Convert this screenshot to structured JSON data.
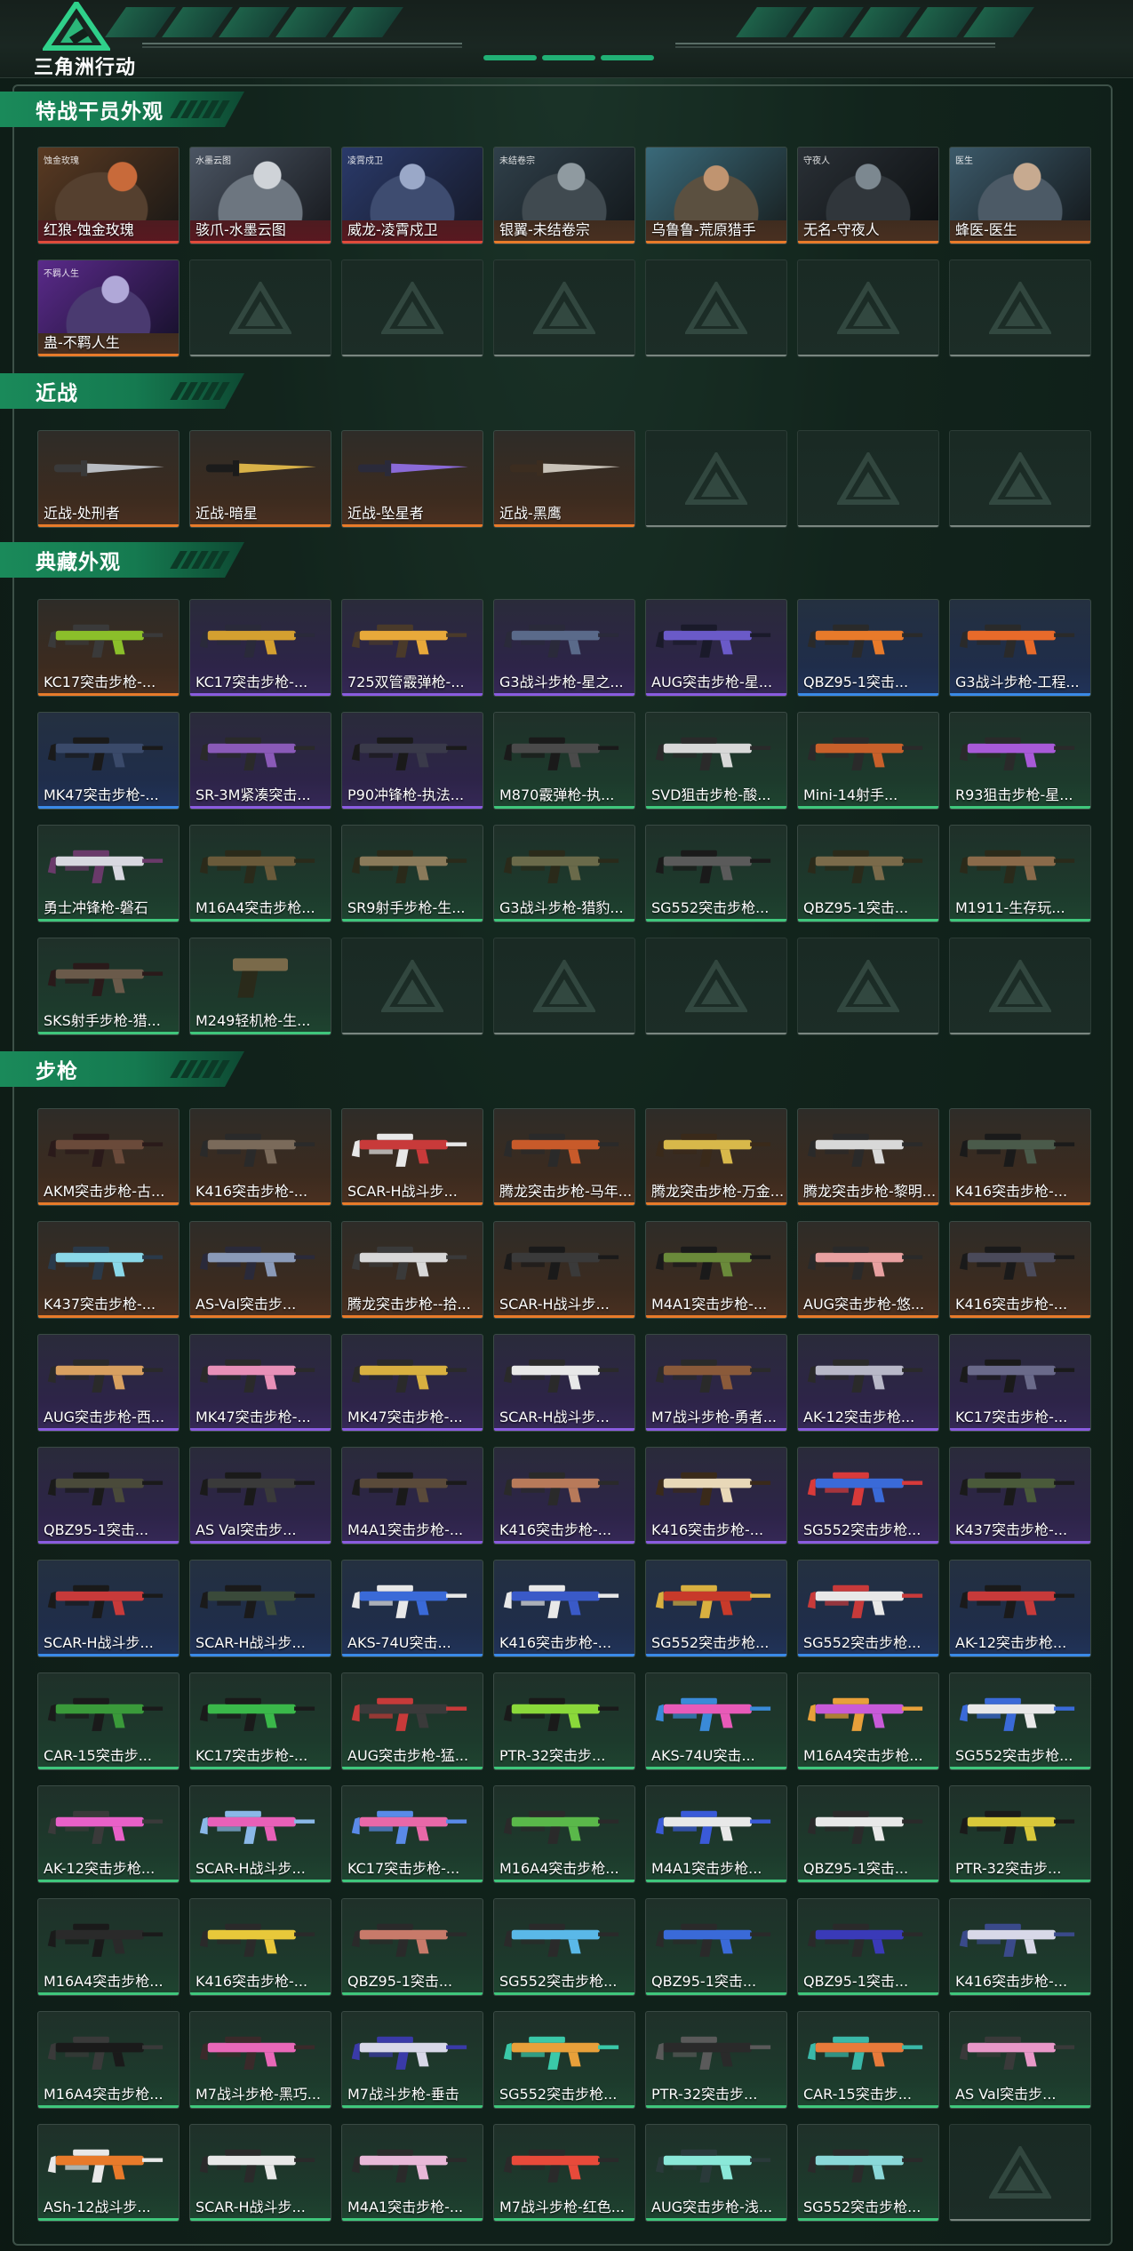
{
  "app": {
    "title": "三角洲行动"
  },
  "sections": [
    {
      "title": "特战干员外观",
      "items": [
        {
          "label": "红狼-蚀金玫瑰",
          "q": "red",
          "kind": "portrait",
          "variant": "p1",
          "tag": "蚀金玫瑰"
        },
        {
          "label": "骇爪-水墨云图",
          "q": "red",
          "kind": "portrait",
          "variant": "p2",
          "tag": "水墨云图"
        },
        {
          "label": "威龙-凌霄戍卫",
          "q": "red",
          "kind": "portrait",
          "variant": "p3",
          "tag": "凌霄戍卫"
        },
        {
          "label": "银翼-未结卷宗",
          "q": "orange",
          "kind": "portrait",
          "variant": "p4",
          "tag": "未结卷宗"
        },
        {
          "label": "乌鲁鲁-荒原猎手",
          "q": "orange",
          "kind": "portrait",
          "variant": "p5",
          "tag": ""
        },
        {
          "label": "无名-守夜人",
          "q": "orange",
          "kind": "portrait",
          "variant": "p6",
          "tag": "守夜人"
        },
        {
          "label": "蜂医-医生",
          "q": "orange",
          "kind": "portrait",
          "variant": "p7",
          "tag": "医生"
        },
        {
          "label": "蛊-不羁人生",
          "q": "orange",
          "kind": "portrait",
          "variant": "p8",
          "tag": "不羁人生"
        },
        {
          "label": "",
          "q": "empty"
        },
        {
          "label": "",
          "q": "empty"
        },
        {
          "label": "",
          "q": "empty"
        },
        {
          "label": "",
          "q": "empty"
        },
        {
          "label": "",
          "q": "empty"
        },
        {
          "label": "",
          "q": "empty"
        }
      ]
    },
    {
      "title": "近战",
      "items": [
        {
          "label": "近战-处刑者",
          "q": "orange",
          "kind": "knife",
          "c1": "#b8bcc2",
          "c2": "#3a3a3a"
        },
        {
          "label": "近战-暗星",
          "q": "orange",
          "kind": "knife",
          "c1": "#d9b248",
          "c2": "#1b1b1b"
        },
        {
          "label": "近战-坠星者",
          "q": "orange",
          "kind": "knife",
          "c1": "#8a6ad8",
          "c2": "#2a2a3a"
        },
        {
          "label": "近战-黑鹰",
          "q": "orange",
          "kind": "knife",
          "c1": "#c8c2b8",
          "c2": "#3c2d20"
        },
        {
          "label": "",
          "q": "empty"
        },
        {
          "label": "",
          "q": "empty"
        },
        {
          "label": "",
          "q": "empty"
        }
      ]
    },
    {
      "title": "典藏外观",
      "items": [
        {
          "label": "KC17突击步枪-...",
          "q": "orange",
          "kind": "gun",
          "c1": "#8bbf2a",
          "c2": "#3a3a3a"
        },
        {
          "label": "KC17突击步枪-...",
          "q": "purple",
          "kind": "gun",
          "c1": "#d4a030",
          "c2": "#2a2a3a"
        },
        {
          "label": "725双管霰弹枪-...",
          "q": "purple",
          "kind": "gun",
          "c1": "#e8a93a",
          "c2": "#4a3a2a"
        },
        {
          "label": "G3战斗步枪-星之...",
          "q": "purple",
          "kind": "gun",
          "c1": "#5a6a8a",
          "c2": "#2a2a3a"
        },
        {
          "label": "AUG突击步枪-星...",
          "q": "purple",
          "kind": "gun",
          "c1": "#6a5ac8",
          "c2": "#1a1a2a"
        },
        {
          "label": "QBZ95-1突击...",
          "q": "blue",
          "kind": "gun",
          "c1": "#e87a2a",
          "c2": "#2a2a2a"
        },
        {
          "label": "G3战斗步枪-工程...",
          "q": "blue",
          "kind": "gun",
          "c1": "#e86a2a",
          "c2": "#2a2a2a"
        },
        {
          "label": "MK47突击步枪-...",
          "q": "blue",
          "kind": "gun",
          "c1": "#3a4a6a",
          "c2": "#1a1a1a"
        },
        {
          "label": "SR-3M紧凑突击...",
          "q": "purple",
          "kind": "gun",
          "c1": "#8a5ab8",
          "c2": "#2a2a2a"
        },
        {
          "label": "P90冲锋枪-执法...",
          "q": "purple",
          "kind": "gun",
          "c1": "#3a3a4a",
          "c2": "#1a1a1a"
        },
        {
          "label": "M870霰弹枪-执...",
          "q": "green",
          "kind": "gun",
          "c1": "#4a4a4a",
          "c2": "#1a1a1a"
        },
        {
          "label": "SVD狙击步枪-酸...",
          "q": "green",
          "kind": "gun",
          "c1": "#d8d8d8",
          "c2": "#2a2a2a"
        },
        {
          "label": "Mini-14射手...",
          "q": "green",
          "kind": "gun",
          "c1": "#c8602a",
          "c2": "#2a2a2a"
        },
        {
          "label": "R93狙击步枪-星...",
          "q": "green",
          "kind": "gun",
          "c1": "#a85ad8",
          "c2": "#2a2a2a"
        },
        {
          "label": "勇士冲锋枪-磐石",
          "q": "green",
          "kind": "gun",
          "c1": "#d8d8e0",
          "c2": "#6a3a6a"
        },
        {
          "label": "M16A4突击步枪...",
          "q": "green",
          "kind": "gun",
          "c1": "#6a5a3a",
          "c2": "#2a2a1a"
        },
        {
          "label": "SR9射手步枪-生...",
          "q": "green",
          "kind": "gun",
          "c1": "#8a7a5a",
          "c2": "#2a2a1a"
        },
        {
          "label": "G3战斗步枪-猎豹...",
          "q": "green",
          "kind": "gun",
          "c1": "#6a6a4a",
          "c2": "#2a2a1a"
        },
        {
          "label": "SG552突击步枪...",
          "q": "green",
          "kind": "gun",
          "c1": "#5a5a5a",
          "c2": "#1a1a1a"
        },
        {
          "label": "QBZ95-1突击...",
          "q": "green",
          "kind": "gun",
          "c1": "#7a6a4a",
          "c2": "#2a2a1a"
        },
        {
          "label": "M1911-生存玩...",
          "q": "green",
          "kind": "gun",
          "c1": "#8a6a4a",
          "c2": "#2a2a1a"
        },
        {
          "label": "SKS射手步枪-猎...",
          "q": "green",
          "kind": "gun",
          "c1": "#6a5a4a",
          "c2": "#2a1a1a"
        },
        {
          "label": "M249轻机枪-生...",
          "q": "green",
          "kind": "pistol",
          "c1": "#7a6a4a",
          "c2": "#2a2a1a"
        },
        {
          "label": "",
          "q": "empty"
        },
        {
          "label": "",
          "q": "empty"
        },
        {
          "label": "",
          "q": "empty"
        },
        {
          "label": "",
          "q": "empty"
        },
        {
          "label": "",
          "q": "empty"
        }
      ]
    },
    {
      "title": "步枪",
      "items": [
        {
          "label": "AKM突击步枪-古...",
          "q": "orange",
          "kind": "gun",
          "c1": "#6a4a3a",
          "c2": "#2a1a1a"
        },
        {
          "label": "K416突击步枪-...",
          "q": "orange",
          "kind": "gun",
          "c1": "#7a6a5a",
          "c2": "#2a2a2a"
        },
        {
          "label": "SCAR-H战斗步...",
          "q": "orange",
          "kind": "gun",
          "c1": "#c83a3a",
          "c2": "#e8e8e8"
        },
        {
          "label": "腾龙突击步枪-马年...",
          "q": "orange",
          "kind": "gun",
          "c1": "#c85a2a",
          "c2": "#2a2a2a"
        },
        {
          "label": "腾龙突击步枪-万金...",
          "q": "orange",
          "kind": "gun",
          "c1": "#d8b84a",
          "c2": "#3a2a1a"
        },
        {
          "label": "腾龙突击步枪-黎明...",
          "q": "orange",
          "kind": "gun",
          "c1": "#d8d8d8",
          "c2": "#2a2a2a"
        },
        {
          "label": "K416突击步枪-...",
          "q": "orange",
          "kind": "gun",
          "c1": "#4a5a4a",
          "c2": "#1a1a1a"
        },
        {
          "label": "K437突击步枪-...",
          "q": "orange",
          "kind": "gun",
          "c1": "#8ad8e8",
          "c2": "#2a3a4a"
        },
        {
          "label": "AS-Val突击步...",
          "q": "orange",
          "kind": "gun",
          "c1": "#8a9ab8",
          "c2": "#2a2a3a"
        },
        {
          "label": "腾龙突击步枪--拾...",
          "q": "orange",
          "kind": "gun",
          "c1": "#d8d8d8",
          "c2": "#3a3a3a"
        },
        {
          "label": "SCAR-H战斗步...",
          "q": "orange",
          "kind": "gun",
          "c1": "#3a3a3a",
          "c2": "#1a1a1a"
        },
        {
          "label": "M4A1突击步枪-...",
          "q": "orange",
          "kind": "gun",
          "c1": "#6a8a3a",
          "c2": "#1a1a1a"
        },
        {
          "label": "AUG突击步枪-悠...",
          "q": "orange",
          "kind": "gun",
          "c1": "#e8a0a0",
          "c2": "#2a2a2a"
        },
        {
          "label": "K416突击步枪-...",
          "q": "orange",
          "kind": "gun",
          "c1": "#4a4a5a",
          "c2": "#1a1a1a"
        },
        {
          "label": "AUG突击步枪-西...",
          "q": "purple",
          "kind": "gun",
          "c1": "#d8a060",
          "c2": "#2a2a2a"
        },
        {
          "label": "MK47突击步枪-...",
          "q": "purple",
          "kind": "gun",
          "c1": "#e890b8",
          "c2": "#2a2a2a"
        },
        {
          "label": "MK47突击步枪-...",
          "q": "purple",
          "kind": "gun",
          "c1": "#d8b040",
          "c2": "#2a2a2a"
        },
        {
          "label": "SCAR-H战斗步...",
          "q": "purple",
          "kind": "gun",
          "c1": "#e8e8e8",
          "c2": "#2a2a2a"
        },
        {
          "label": "M7战斗步枪-勇者...",
          "q": "purple",
          "kind": "gun",
          "c1": "#8a5a3a",
          "c2": "#2a2a2a"
        },
        {
          "label": "AK-12突击步枪...",
          "q": "purple",
          "kind": "gun",
          "c1": "#b8b8c8",
          "c2": "#2a2a2a"
        },
        {
          "label": "KC17突击步枪-...",
          "q": "purple",
          "kind": "gun",
          "c1": "#6a6a8a",
          "c2": "#1a1a1a"
        },
        {
          "label": "QBZ95-1突击...",
          "q": "purple",
          "kind": "gun",
          "c1": "#4a4a3a",
          "c2": "#1a1a1a"
        },
        {
          "label": "AS Val突击步...",
          "q": "purple",
          "kind": "gun",
          "c1": "#3a3a3a",
          "c2": "#1a1a1a"
        },
        {
          "label": "M4A1突击步枪-...",
          "q": "purple",
          "kind": "gun",
          "c1": "#5a4a3a",
          "c2": "#1a1a1a"
        },
        {
          "label": "K416突击步枪-...",
          "q": "purple",
          "kind": "gun",
          "c1": "#b87a5a",
          "c2": "#2a2a2a"
        },
        {
          "label": "K416突击步枪-...",
          "q": "purple",
          "kind": "gun",
          "c1": "#e8d8b8",
          "c2": "#3a2a1a"
        },
        {
          "label": "SG552突击步枪...",
          "q": "purple",
          "kind": "gun",
          "c1": "#3a6ad8",
          "c2": "#d83a3a"
        },
        {
          "label": "K437突击步枪-...",
          "q": "purple",
          "kind": "gun",
          "c1": "#4a5a3a",
          "c2": "#1a1a1a"
        },
        {
          "label": "SCAR-H战斗步...",
          "q": "blue",
          "kind": "gun",
          "c1": "#c83a3a",
          "c2": "#1a1a1a"
        },
        {
          "label": "SCAR-H战斗步...",
          "q": "blue",
          "kind": "gun",
          "c1": "#3a4a3a",
          "c2": "#1a1a1a"
        },
        {
          "label": "AKS-74U突击...",
          "q": "blue",
          "kind": "gun",
          "c1": "#3a6ad8",
          "c2": "#e8e8e8"
        },
        {
          "label": "K416突击步枪-...",
          "q": "blue",
          "kind": "gun",
          "c1": "#3a5ac8",
          "c2": "#e8e8e8"
        },
        {
          "label": "SG552突击步枪...",
          "q": "blue",
          "kind": "gun",
          "c1": "#c83a2a",
          "c2": "#d8b040"
        },
        {
          "label": "SG552突击步枪...",
          "q": "blue",
          "kind": "gun",
          "c1": "#e8e8e8",
          "c2": "#c83a3a"
        },
        {
          "label": "AK-12突击步枪...",
          "q": "blue",
          "kind": "gun",
          "c1": "#c83a3a",
          "c2": "#1a1a1a"
        },
        {
          "label": "CAR-15突击步...",
          "q": "green",
          "kind": "gun",
          "c1": "#3a9a3a",
          "c2": "#1a1a1a"
        },
        {
          "label": "KC17突击步枪-...",
          "q": "green",
          "kind": "gun",
          "c1": "#3ab84a",
          "c2": "#1a1a1a"
        },
        {
          "label": "AUG突击步枪-猛...",
          "q": "green",
          "kind": "gun",
          "c1": "#3a3a3a",
          "c2": "#c83a3a"
        },
        {
          "label": "PTR-32突击步...",
          "q": "green",
          "kind": "gun",
          "c1": "#8ad83a",
          "c2": "#1a1a1a"
        },
        {
          "label": "AKS-74U突击...",
          "q": "green",
          "kind": "gun",
          "c1": "#e85ab8",
          "c2": "#3a8ad8"
        },
        {
          "label": "M16A4突击步枪...",
          "q": "green",
          "kind": "gun",
          "c1": "#c85ad8",
          "c2": "#e8a03a"
        },
        {
          "label": "SG552突击步枪...",
          "q": "green",
          "kind": "gun",
          "c1": "#e8e8e8",
          "c2": "#3a6ad8"
        },
        {
          "label": "AK-12突击步枪...",
          "q": "green",
          "kind": "gun",
          "c1": "#e860c8",
          "c2": "#3a3a3a"
        },
        {
          "label": "SCAR-H战斗步...",
          "q": "green",
          "kind": "gun",
          "c1": "#e860b8",
          "c2": "#8ab8e8"
        },
        {
          "label": "KC17突击步枪-...",
          "q": "green",
          "kind": "gun",
          "c1": "#e868a8",
          "c2": "#5a8ae8"
        },
        {
          "label": "M16A4突击步枪...",
          "q": "green",
          "kind": "gun",
          "c1": "#5ab84a",
          "c2": "#2a2a2a"
        },
        {
          "label": "M4A1突击步枪...",
          "q": "green",
          "kind": "gun",
          "c1": "#e8e8e8",
          "c2": "#3a5ad8"
        },
        {
          "label": "QBZ95-1突击...",
          "q": "green",
          "kind": "gun",
          "c1": "#e8e8e8",
          "c2": "#2a2a2a"
        },
        {
          "label": "PTR-32突击步...",
          "q": "green",
          "kind": "gun",
          "c1": "#d8c83a",
          "c2": "#1a1a1a"
        },
        {
          "label": "M16A4突击步枪...",
          "q": "green",
          "kind": "gun",
          "c1": "#2a2a2a",
          "c2": "#1a1a1a"
        },
        {
          "label": "K416突击步枪-...",
          "q": "green",
          "kind": "gun",
          "c1": "#e8c83a",
          "c2": "#2a2a2a"
        },
        {
          "label": "QBZ95-1突击...",
          "q": "green",
          "kind": "gun",
          "c1": "#c87a6a",
          "c2": "#2a2a2a"
        },
        {
          "label": "SG552突击步枪...",
          "q": "green",
          "kind": "gun",
          "c1": "#5ab8e8",
          "c2": "#2a2a2a"
        },
        {
          "label": "QBZ95-1突击...",
          "q": "green",
          "kind": "gun",
          "c1": "#3a6ad8",
          "c2": "#2a2a2a"
        },
        {
          "label": "QBZ95-1突击...",
          "q": "green",
          "kind": "gun",
          "c1": "#3a3ab8",
          "c2": "#2a2a2a"
        },
        {
          "label": "K416突击步枪-...",
          "q": "green",
          "kind": "gun",
          "c1": "#d8d8e8",
          "c2": "#3a4a8a"
        },
        {
          "label": "M16A4突击步枪...",
          "q": "green",
          "kind": "gun",
          "c1": "#1a1a1a",
          "c2": "#3a3a3a"
        },
        {
          "label": "M7战斗步枪-黑巧...",
          "q": "green",
          "kind": "gun",
          "c1": "#e868b8",
          "c2": "#3a2a2a"
        },
        {
          "label": "M7战斗步枪-垂击",
          "q": "green",
          "kind": "gun",
          "c1": "#d8d8e8",
          "c2": "#3a3aa8"
        },
        {
          "label": "SG552突击步枪...",
          "q": "green",
          "kind": "gun",
          "c1": "#e8a03a",
          "c2": "#3ac8a8"
        },
        {
          "label": "PTR-32突击步...",
          "q": "green",
          "kind": "gun",
          "c1": "#2a2a2a",
          "c2": "#5a5a5a"
        },
        {
          "label": "CAR-15突击步...",
          "q": "green",
          "kind": "gun",
          "c1": "#e87a3a",
          "c2": "#3ab8a8"
        },
        {
          "label": "AS Val突击步...",
          "q": "green",
          "kind": "gun",
          "c1": "#e898c8",
          "c2": "#3a3a3a"
        },
        {
          "label": "ASh-12战斗步...",
          "q": "green",
          "kind": "gun",
          "c1": "#e87a2a",
          "c2": "#e8e8e8"
        },
        {
          "label": "SCAR-H战斗步...",
          "q": "green",
          "kind": "gun",
          "c1": "#e8e8e8",
          "c2": "#2a2a2a"
        },
        {
          "label": "M4A1突击步枪-...",
          "q": "green",
          "kind": "gun",
          "c1": "#e8b8d8",
          "c2": "#2a2a2a"
        },
        {
          "label": "M7战斗步枪-红色...",
          "q": "green",
          "kind": "gun",
          "c1": "#e84a3a",
          "c2": "#2a2a2a"
        },
        {
          "label": "AUG突击步枪-浅...",
          "q": "green",
          "kind": "gun",
          "c1": "#8ae8d8",
          "c2": "#2a3a3a"
        },
        {
          "label": "SG552突击步枪...",
          "q": "green",
          "kind": "gun",
          "c1": "#8ad8d8",
          "c2": "#2a2a2a"
        },
        {
          "label": "",
          "q": "empty"
        }
      ]
    }
  ]
}
